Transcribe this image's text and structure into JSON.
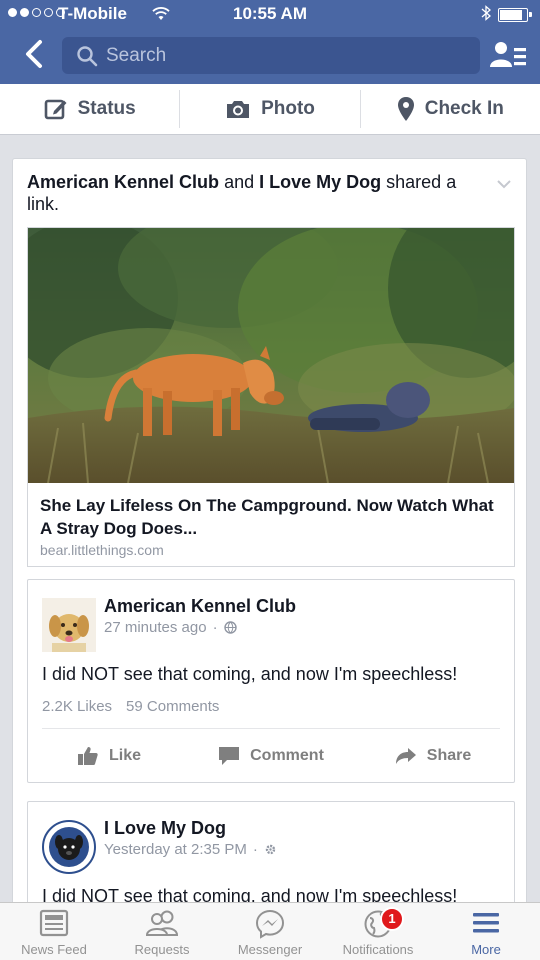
{
  "status_bar": {
    "carrier": "T-Mobile",
    "time": "10:55 AM",
    "signal_bars": 2,
    "signal_total": 5,
    "battery_level": 0.85
  },
  "nav": {
    "search_placeholder": "Search"
  },
  "composer": {
    "status_label": "Status",
    "photo_label": "Photo",
    "checkin_label": "Check In"
  },
  "story": {
    "actor1": "American Kennel Club",
    "connector": "and",
    "actor2": "I Love My Dog",
    "verb": "shared a link.",
    "link": {
      "title": "She Lay Lifeless On The Campground. Now Watch What A Stray Dog Does...",
      "domain": "bear.littlethings.com"
    }
  },
  "posts": [
    {
      "author": "American Kennel Club",
      "time": "27 minutes ago",
      "text": "I did NOT see that coming, and now I'm speechless!",
      "likes": "2.2K Likes",
      "comments": "59 Comments",
      "actions": {
        "like": "Like",
        "comment": "Comment",
        "share": "Share"
      }
    },
    {
      "author": "I Love My Dog",
      "time": "Yesterday at 2:35 PM",
      "text": "I did NOT see that coming, and now I'm speechless!"
    }
  ],
  "tabbar": {
    "items": [
      {
        "label": "News Feed",
        "icon": "news-feed-icon"
      },
      {
        "label": "Requests",
        "icon": "friends-icon"
      },
      {
        "label": "Messenger",
        "icon": "messenger-icon"
      },
      {
        "label": "Notifications",
        "icon": "globe-icon",
        "badge": "1"
      },
      {
        "label": "More",
        "icon": "menu-icon"
      }
    ],
    "active_index": 4
  },
  "colors": {
    "brand": "#4a67a4",
    "badge": "#e0191c"
  }
}
